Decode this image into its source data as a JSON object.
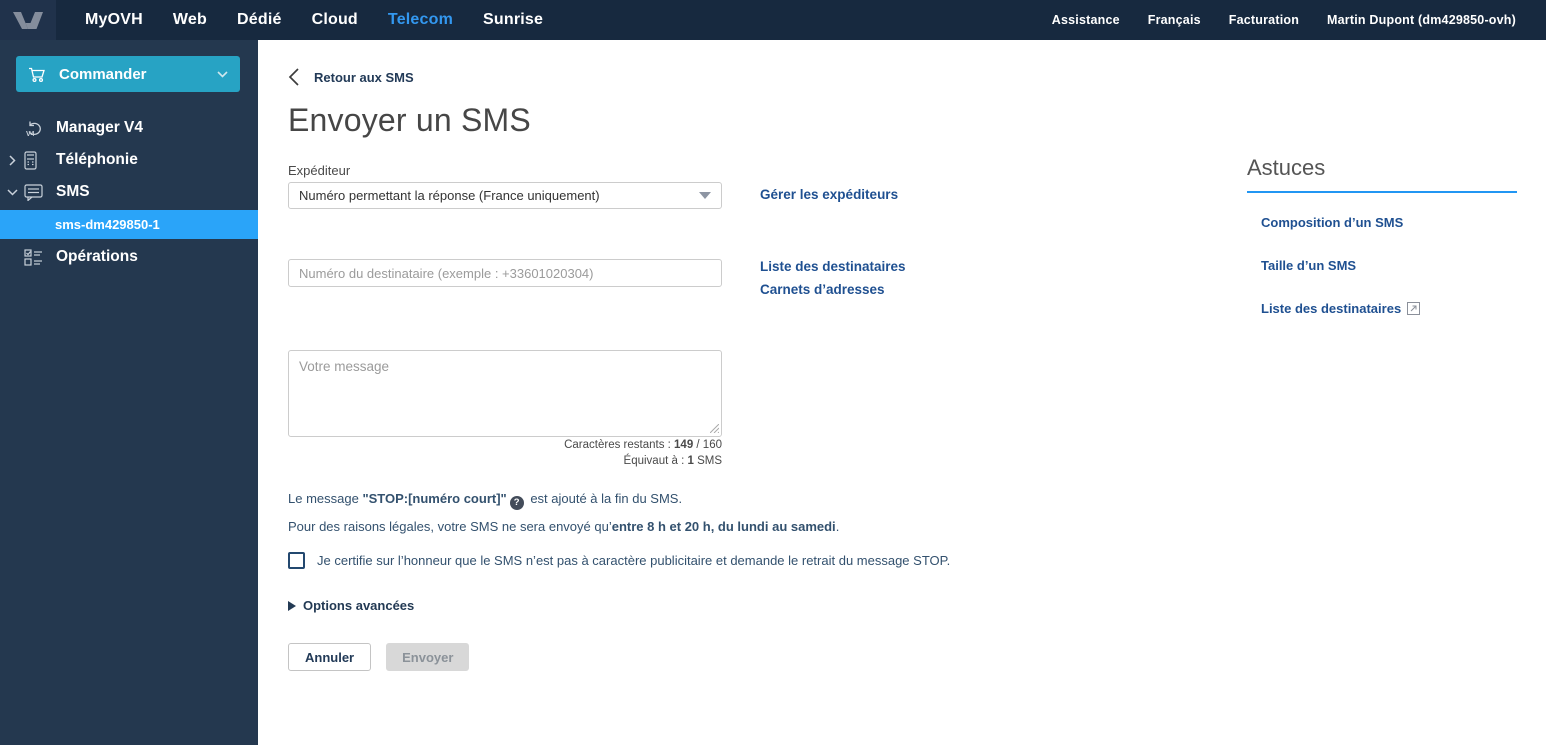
{
  "topnav": {
    "items": [
      "MyOVH",
      "Web",
      "Dédié",
      "Cloud",
      "Telecom",
      "Sunrise"
    ],
    "right": [
      "Assistance",
      "Français",
      "Facturation",
      "Martin Dupont (dm429850-ovh)"
    ]
  },
  "sidebar": {
    "commander": "Commander",
    "manager": "Manager V4",
    "telephonie": "Téléphonie",
    "sms": "SMS",
    "active_item": "sms-dm429850-1",
    "operations": "Opérations"
  },
  "main": {
    "back": "Retour aux SMS",
    "title": "Envoyer un SMS"
  },
  "form": {
    "sender": {
      "label": "Expéditeur",
      "value": "Numéro permettant la réponse (France uniquement)",
      "manage": "Gérer les expéditeurs"
    },
    "recipient": {
      "placeholder": "Numéro du destinataire (exemple : +33601020304)",
      "link1": "Liste des destinataires",
      "link2": "Carnets d’adresses"
    },
    "message": {
      "placeholder": "Votre message",
      "remaining_label": "Caractères restants : ",
      "remaining_value": "149",
      "remaining_total": " / 160",
      "equivalent_label": "Équivaut à : ",
      "equivalent_value": "1",
      "equivalent_suffix": " SMS"
    }
  },
  "legal": {
    "l1_pre": "Le message ",
    "l1_bold": "\"STOP:[numéro court]\"",
    "l1_help": "?",
    "l1_post": " est ajouté à la fin du SMS.",
    "l2_pre": "Pour des raisons légales, votre SMS ne sera envoyé qu’",
    "l2_bold": "entre 8 h et 20 h, du lundi au samedi",
    "l2_post": ".",
    "checkbox": "Je certifie sur l’honneur que le SMS n’est pas à caractère publicitaire et demande le retrait du message STOP.",
    "options": "Options avancées"
  },
  "buttons": {
    "cancel": "Annuler",
    "send": "Envoyer"
  },
  "aside": {
    "title": "Astuces",
    "links": [
      "Composition d’un SMS",
      "Taille d’un SMS",
      "Liste des destinataires"
    ]
  },
  "colors": {
    "navbar_bg": "#17293f",
    "brand_bg": "#20324b",
    "sidebar_bg": "#24384f",
    "commander_teal": "#27a3c4",
    "active_tab_blue": "#3398f0",
    "active_item_blue": "#2aa4f9",
    "link_navy": "#1f5091",
    "text_navy": "#33516e",
    "astuces_underline": "#2196f3",
    "disabled_button_bg": "#d8d8d8"
  }
}
